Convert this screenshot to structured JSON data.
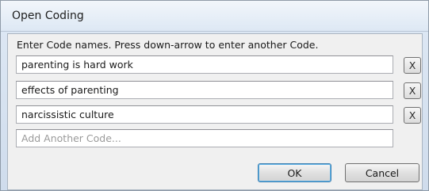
{
  "window": {
    "title": "Open Coding"
  },
  "instruction": "Enter Code names. Press down-arrow to enter another Code.",
  "codes": [
    {
      "value": "parenting is hard work",
      "remove_label": "X"
    },
    {
      "value": "effects of parenting",
      "remove_label": "X"
    },
    {
      "value": "narcissistic culture",
      "remove_label": "X"
    }
  ],
  "new_code": {
    "value": "",
    "placeholder": "Add Another Code..."
  },
  "buttons": {
    "ok_label": "OK",
    "cancel_label": "Cancel"
  }
}
